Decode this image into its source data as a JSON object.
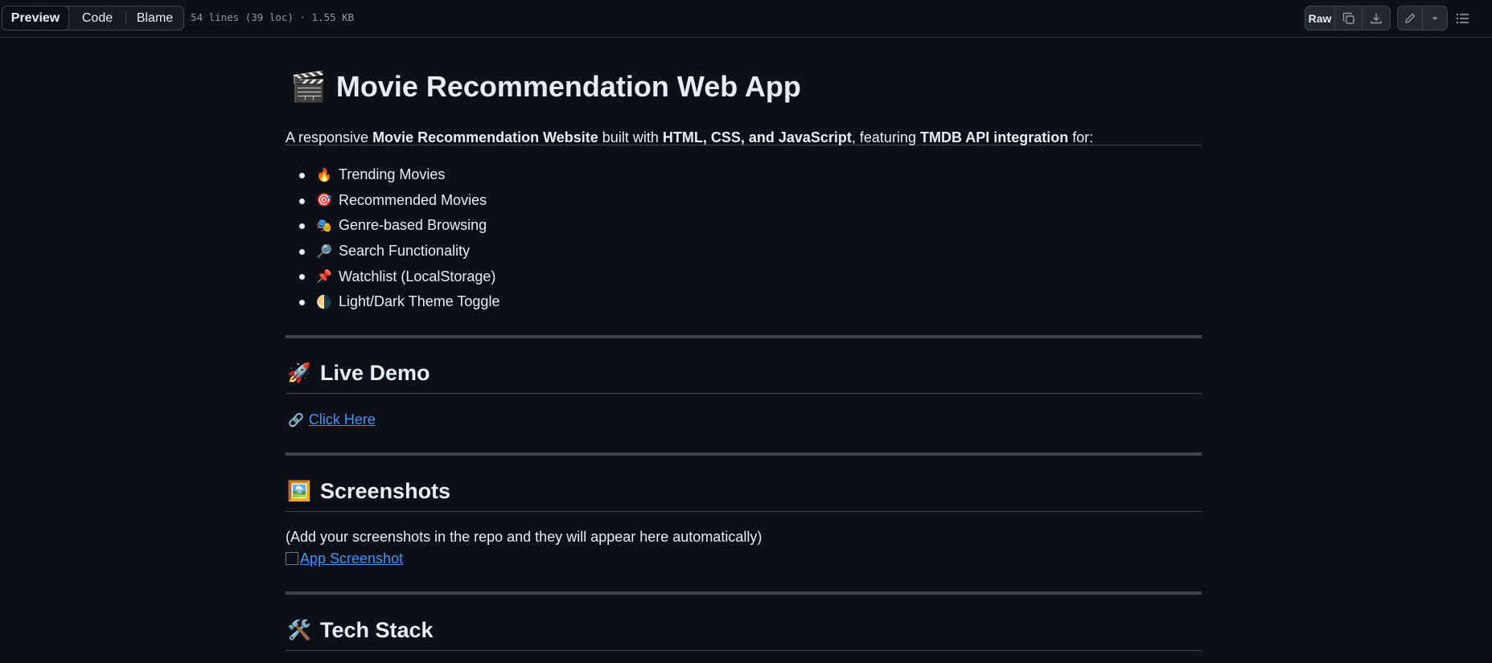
{
  "toolbar": {
    "tabs": [
      "Preview",
      "Code",
      "Blame"
    ],
    "file_info": "54 lines (39 loc) · 1.55 KB",
    "raw_label": "Raw"
  },
  "readme": {
    "title_emoji": "🎬",
    "title": "Movie Recommendation Web App",
    "intro": {
      "t1": "A responsive ",
      "b1": "Movie Recommendation Website",
      "t2": " built with ",
      "b2": "HTML, CSS, and JavaScript",
      "t3": ", featuring ",
      "b3": "TMDB API integration",
      "t4": " for:"
    },
    "features": [
      {
        "icon": "🔥",
        "label": "Trending Movies"
      },
      {
        "icon": "🎯",
        "label": "Recommended Movies"
      },
      {
        "icon": "🎭",
        "label": "Genre-based Browsing"
      },
      {
        "icon": "🔎",
        "label": "Search Functionality"
      },
      {
        "icon": "📌",
        "label": "Watchlist (LocalStorage)"
      },
      {
        "icon": "🌗",
        "label": "Light/Dark Theme Toggle"
      }
    ],
    "live_demo": {
      "emoji": "🚀",
      "heading": "Live Demo",
      "link_icon": "🔗",
      "link_text": "Click Here"
    },
    "screenshots": {
      "emoji": "🖼️",
      "heading": "Screenshots",
      "note": "(Add your screenshots in the repo and they will appear here automatically)",
      "image_alt": "App Screenshot"
    },
    "tech_stack": {
      "emoji": "🛠️",
      "heading": "Tech Stack"
    }
  }
}
